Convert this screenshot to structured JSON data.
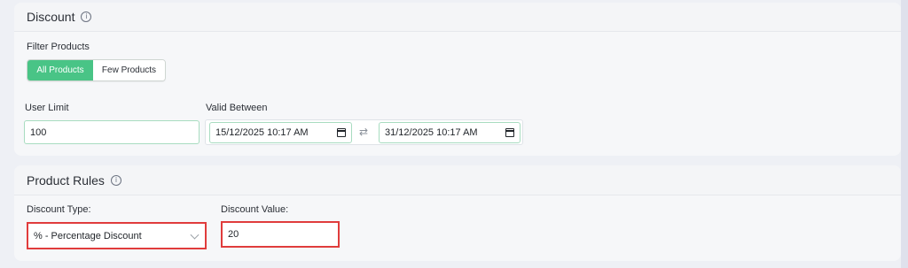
{
  "discount": {
    "title": "Discount",
    "info_icon": "info-icon",
    "filter_label": "Filter Products",
    "filter_options": [
      "All Products",
      "Few Products"
    ],
    "filter_selected": "All Products",
    "user_limit_label": "User Limit",
    "user_limit_value": "100",
    "valid_between_label": "Valid Between",
    "valid_from": "15/12/2025 10:17 AM",
    "valid_to": "31/12/2025 10:17 AM",
    "swap_icon": "swap-arrows-icon"
  },
  "product_rules": {
    "title": "Product Rules",
    "info_icon": "info-icon",
    "discount_type_label": "Discount Type:",
    "discount_type_value": "% - Percentage Discount",
    "discount_value_label": "Discount Value:",
    "discount_value": "20"
  },
  "colors": {
    "accent": "#49c486",
    "highlight": "#e03c3c",
    "field_border": "#a8dcc0"
  }
}
